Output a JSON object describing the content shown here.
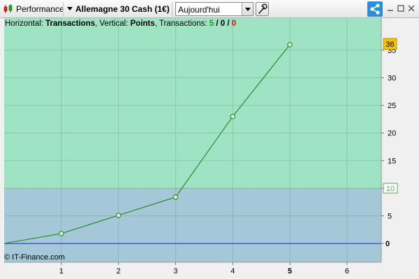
{
  "toolbar": {
    "app_label": "Performance",
    "instrument": "Allemagne 30 Cash (1€)",
    "period": "Aujourd'hui",
    "icons": [
      "candlestick-icon",
      "chevron-down-icon",
      "wrench-icon",
      "share-icon",
      "minimize-icon",
      "maximize-icon",
      "close-icon"
    ]
  },
  "legend": {
    "h_label": "Horizontal: ",
    "h_value": "Transactions",
    "v_label": ", Vertical: ",
    "v_value": "Points",
    "t_label": ", Transactions: ",
    "t_win": "5",
    "t_sep1": " / ",
    "t_even": "0",
    "t_sep2": " / ",
    "t_loss": "0"
  },
  "copyright": "© IT-Finance.com",
  "colors": {
    "upper_zone": "#9ee3c4",
    "lower_zone": "#a4c8d8",
    "line": "#2a8a2a",
    "zero_line": "#2020e0",
    "last_value_badge": "#f2c200",
    "threshold_badge": "#5ca85c"
  },
  "chart_data": {
    "type": "line",
    "x": [
      0,
      1,
      2,
      3,
      4,
      5
    ],
    "y": [
      0,
      1.8,
      5.1,
      8.4,
      23,
      36
    ],
    "xlim": [
      0,
      6.6
    ],
    "ylim": [
      -3.4,
      40.8
    ],
    "x_ticks": [
      "1",
      "2",
      "3",
      "4",
      "5",
      "6"
    ],
    "x_highlight": "5",
    "y_ticks": [
      "0",
      "5",
      "10",
      "15",
      "20",
      "25",
      "30",
      "35"
    ],
    "threshold": 10,
    "threshold_label": "10",
    "last_value_label": "36",
    "zero_label": "0",
    "grid": true
  }
}
